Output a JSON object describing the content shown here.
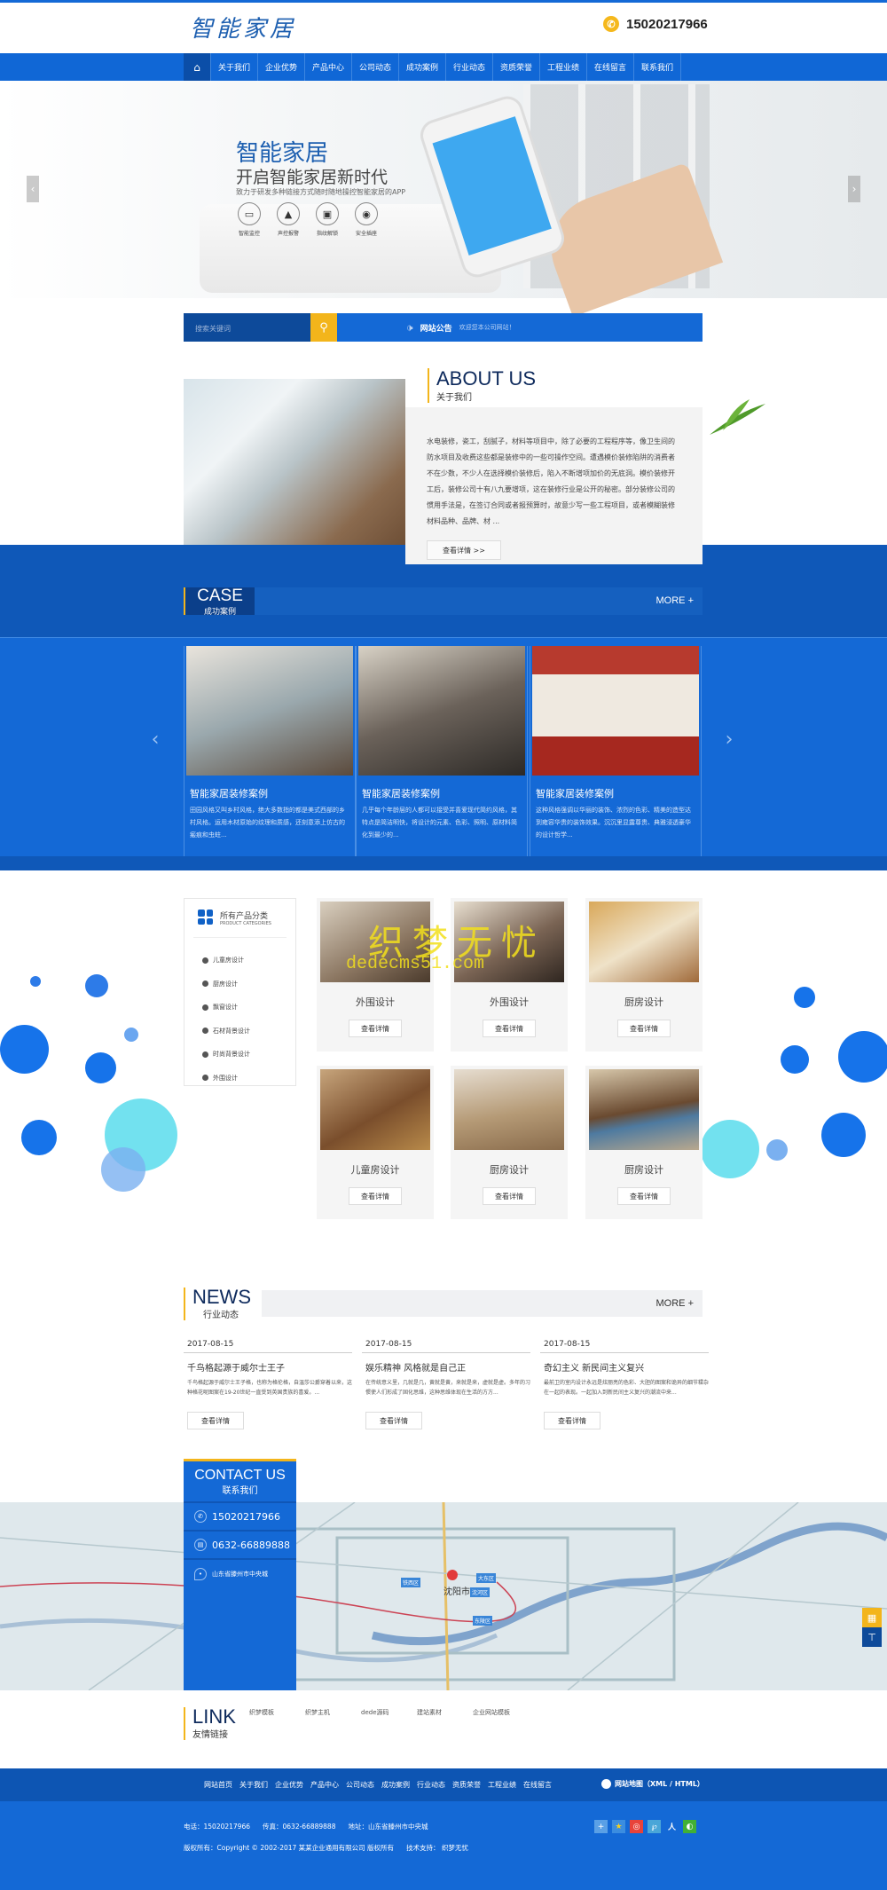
{
  "header": {
    "logo": "智能家居",
    "phone": "15020217966"
  },
  "nav": {
    "home_icon": "home-icon",
    "items": [
      "关于我们",
      "企业优势",
      "产品中心",
      "公司动态",
      "成功案例",
      "行业动态",
      "资质荣誉",
      "工程业绩",
      "在线留言",
      "联系我们"
    ]
  },
  "banner": {
    "title": "智能家居",
    "subtitle": "开启智能家居新时代",
    "desc": "致力于研发多种链接方式随时随地操控智能家居的APP",
    "features": [
      {
        "icon": "camera-icon",
        "label": "智能监控"
      },
      {
        "icon": "alarm-icon",
        "label": "声控报警"
      },
      {
        "icon": "lock-icon",
        "label": "指纹解锁"
      },
      {
        "icon": "socket-icon",
        "label": "安全插座"
      }
    ]
  },
  "search": {
    "placeholder": "搜索关键词",
    "notice_label": "网站公告",
    "notice_text": "欢迎您本公司网站！"
  },
  "about": {
    "en": "ABOUT US",
    "cn": "关于我们",
    "text": "水电装修，瓷工，刮腻子，材料等项目中，除了必要的工程程序等，像卫生间的防水项目及收费这些都是装修中的一些可操作空间。遭遇模价装修陷阱的消费者不在少数，不少人在选择模价装修后，陷入不断增项加价的无底洞。模价装修开工后，装修公司十有八九要增项，这在装修行业是公开的秘密。部分装修公司的惯用手法是，在签订合同或者报预算时，故意少写一些工程项目，或者模糊装修材料品种、品牌、材 ...",
    "button": "查看详情 >>"
  },
  "cases": {
    "en": "CASE",
    "cn": "成功案例",
    "more": "MORE +",
    "items": [
      {
        "title": "智能家居装修案例",
        "text": "田园风格又叫乡村风格，绝大多数指的都是美式西部的乡村风格。运用木材原始的纹理和质感，还刻意添上仿古的瘢痕和虫蛀..."
      },
      {
        "title": "智能家居装修案例",
        "text": "几乎每个年龄层的人都可以接受并喜爱现代简约风格，其特点是简洁明快，将设计的元素、色彩、照明、原材料简化到最少的..."
      },
      {
        "title": "智能家居装修案例",
        "text": "这种风格强调以华丽的装饰、浓烈的色彩、精美的造型达到雍容华贵的装饰效果。沉沉里显露尊贵、典雅浸透豪华的设计哲学..."
      }
    ]
  },
  "products": {
    "title": "所有产品分类",
    "subtitle": "PRODUCT CATEGORIES",
    "categories": [
      "儿童房设计",
      "厨房设计",
      "飘窗设计",
      "石材背景设计",
      "时尚背景设计",
      "外围设计"
    ],
    "items": [
      {
        "name": "外围设计",
        "button": "查看详情"
      },
      {
        "name": "外围设计",
        "button": "查看详情"
      },
      {
        "name": "厨房设计",
        "button": "查看详情"
      },
      {
        "name": "儿童房设计",
        "button": "查看详情"
      },
      {
        "name": "厨房设计",
        "button": "查看详情"
      },
      {
        "name": "厨房设计",
        "button": "查看详情"
      }
    ],
    "watermark_cn": "织梦无忧",
    "watermark_en": "dedecms51.com"
  },
  "news": {
    "en": "NEWS",
    "cn": "行业动态",
    "more": "MORE +",
    "items": [
      {
        "date": "2017-08-15",
        "title": "千鸟格起源于威尔士王子",
        "text": "千鸟格起源于威尔士王子格，也称为格伦格，自温莎公爵穿着以来，这种格花呢图案在19-20世纪一直受到英国贵族的喜爱。...",
        "button": "查看详情"
      },
      {
        "date": "2017-08-15",
        "title": "娱乐精神 风格就是自己正",
        "text": "在传统意义里，几就是几，黄就是黄，来就是来，虚就是虚。多年的习惯使人们形成了固化思维，这种思维体现在生活的方方...",
        "button": "查看详情"
      },
      {
        "date": "2017-08-15",
        "title": "奇幻主义 新民间主义复兴",
        "text": "最前卫的室内设计永远是炫丽亮的色彩、大胆的图案和诡异的细节糅杂在一起的表现。一起加入到新民间主义复兴的潮流中来...",
        "button": "查看详情"
      }
    ]
  },
  "contact": {
    "en": "CONTACT US",
    "cn": "联系我们",
    "phone": "15020217966",
    "fax": "0632-66889888",
    "address": "山东省滕州市中央城"
  },
  "map": {
    "city": "沈阳市",
    "districts": [
      "铁西区",
      "大东区",
      "沈河区",
      "东陵区"
    ]
  },
  "links": {
    "en": "LINK",
    "cn": "友情链接",
    "items": [
      "织梦模板",
      "织梦主机",
      "dede源码",
      "建站素材",
      "企业网站模板"
    ]
  },
  "footer": {
    "nav": [
      "网站首页",
      "关于我们",
      "企业优势",
      "产品中心",
      "公司动态",
      "成功案例",
      "行业动态",
      "资质荣誉",
      "工程业绩",
      "在线留言"
    ],
    "sitemap": "网站地图（XML / HTML）",
    "tel": "电话：15020217966",
    "fax": "传真：0632-66889888",
    "address": "地址：山东省滕州市中央城",
    "copyright": "版权所有：Copyright © 2002-2017 某某企业通用有限公司 版权所有",
    "support": "技术支持： 织梦无忧"
  },
  "colors": {
    "primary": "#1469d6",
    "dark": "#0d55b3",
    "accent": "#f3b51b"
  }
}
